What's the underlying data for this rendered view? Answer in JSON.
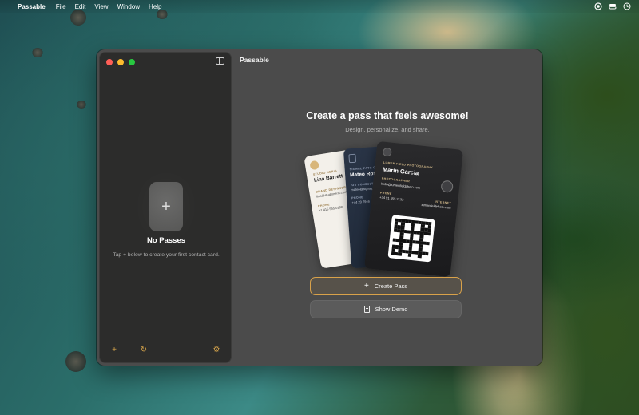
{
  "menubar": {
    "apple_icon": "apple-logo-icon",
    "app_name": "Passable",
    "items": [
      "File",
      "Edit",
      "View",
      "Window",
      "Help"
    ]
  },
  "window": {
    "title": "Passable"
  },
  "sidebar": {
    "empty_title": "No Passes",
    "empty_subtitle": "Tap + below to create your first contact card.",
    "add_glyph": "+",
    "bottom_add_glyph": "+",
    "refresh_glyph": "↻",
    "gear_glyph": "⚙"
  },
  "hero": {
    "title": "Create a pass that feels awesome!",
    "subtitle": "Design, personalize, and share."
  },
  "cards": {
    "white": {
      "label": "STUDIO NERIS",
      "name": "Lina Barrett",
      "role": "BRAND DESIGNER",
      "email": "lina@studioneris.com",
      "phone_label": "PHONE",
      "phone": "+1 415 555 0198"
    },
    "navy": {
      "label": "SIGNAL PATH CO",
      "name": "Mateo Ross",
      "role": "IOS CONSULTANT",
      "email": "mateo@signalpath.co",
      "phone_label": "PHONE",
      "phone": "+44 20 7946 0321"
    },
    "black": {
      "label": "LUMEN FIELD PHOTOGRAPHY",
      "name": "Marin Garcia",
      "role": "PHOTOGRAPHER",
      "email": "hello@lumenfieldphoto.com",
      "phone_label": "PHONE",
      "phone": "+34 91 555 2132",
      "internet_label": "INTERNET",
      "internet": "lumenfieldphoto.com"
    }
  },
  "buttons": {
    "create": "Create Pass",
    "demo": "Show Demo"
  },
  "colors": {
    "accent": "#d9a24a",
    "close": "#ff5f57",
    "minimize": "#febc2e",
    "maximize": "#28c840"
  }
}
